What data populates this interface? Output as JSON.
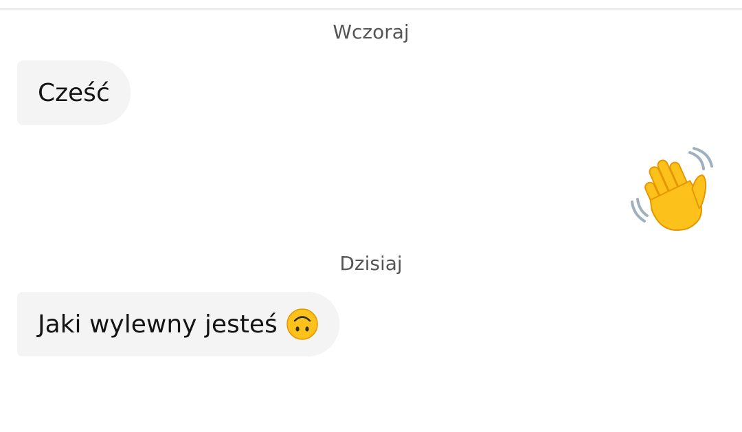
{
  "conversation": {
    "separators": {
      "yesterday": "Wczoraj",
      "today": "Dzisiaj"
    },
    "messages": [
      {
        "direction": "incoming",
        "text": "Cześć",
        "icon": null
      },
      {
        "direction": "outgoing",
        "text": "",
        "icon": "waving-hand-icon"
      },
      {
        "direction": "incoming",
        "text": "Jaki wylewny jesteś",
        "icon": "upside-down-face-icon"
      }
    ]
  },
  "colors": {
    "incoming_bubble": "#f4f4f4",
    "separator_text": "#555555",
    "message_text": "#141414",
    "emoji_yellow": "#fcc21b"
  }
}
